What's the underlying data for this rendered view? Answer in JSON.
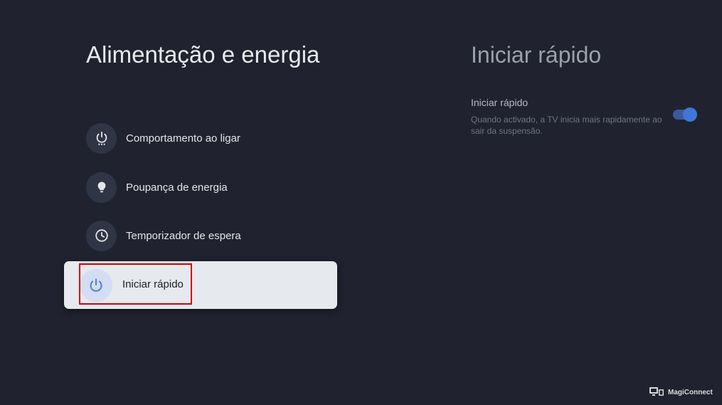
{
  "left_panel": {
    "title": "Alimentação e energia",
    "items": [
      {
        "label": "Comportamento ao ligar",
        "icon": "power-dots-icon"
      },
      {
        "label": "Poupança de energia",
        "icon": "bulb-icon"
      },
      {
        "label": "Temporizador de espera",
        "icon": "clock-icon"
      },
      {
        "label": "Iniciar rápido",
        "icon": "power-icon",
        "selected": true
      }
    ]
  },
  "right_panel": {
    "title": "Iniciar rápido",
    "setting": {
      "title": "Iniciar rápido",
      "description": "Quando activado, a TV inicia mais rapidamente ao sair da suspensão.",
      "enabled": true
    }
  },
  "brand": {
    "label": "MagiConnect",
    "icon": "cast-devices-icon"
  },
  "colors": {
    "background": "#20232f",
    "accent": "#3f77d9",
    "highlight": "#d60000"
  }
}
